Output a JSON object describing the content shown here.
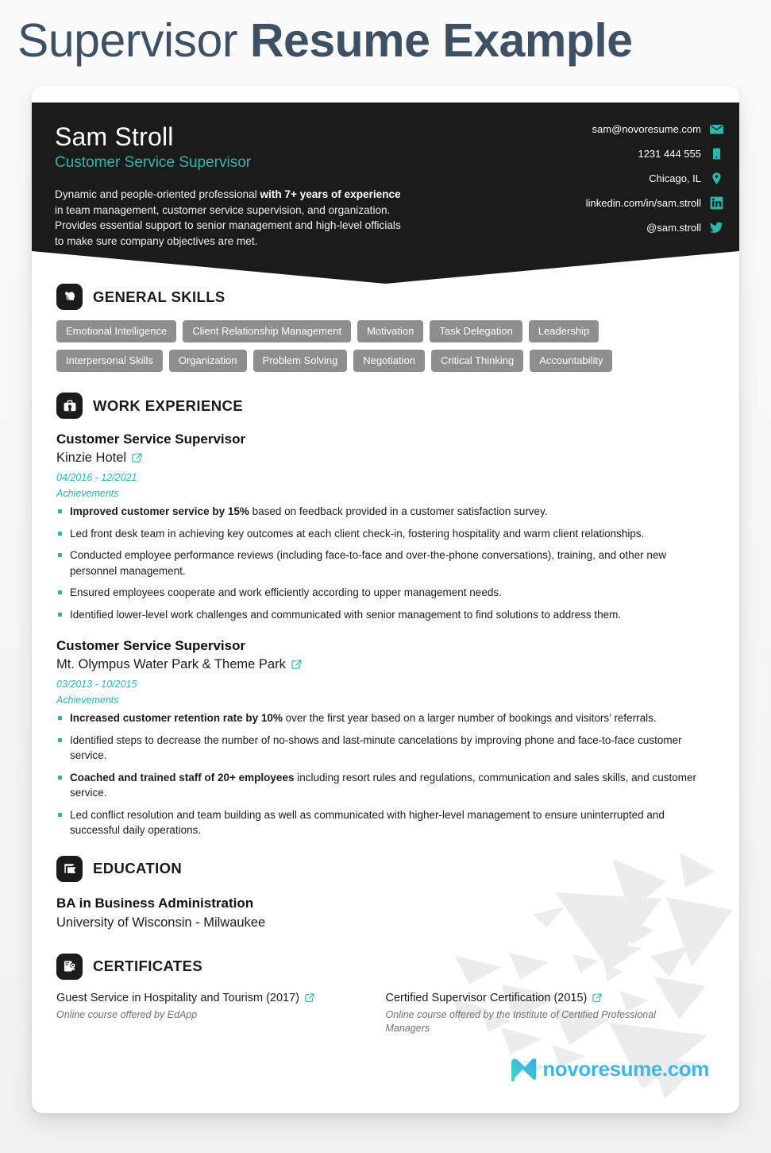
{
  "title": {
    "light": "Supervisor ",
    "bold": "Resume Example"
  },
  "header": {
    "name": "Sam Stroll",
    "role": "Customer Service Supervisor",
    "summary_pre": "Dynamic and people-oriented professional ",
    "summary_bold": "with 7+ years of experience",
    "summary_post": " in team management, customer service supervision, and organization. Provides essential support to senior management and high-level officials to make sure company objectives are met.",
    "contacts": [
      {
        "icon": "email-icon",
        "text": "sam@novoresume.com"
      },
      {
        "icon": "phone-icon",
        "text": "1231 444 555"
      },
      {
        "icon": "location-pin-icon",
        "text": "Chicago, IL"
      },
      {
        "icon": "linkedin-icon",
        "text": "linkedin.com/in/sam.stroll"
      },
      {
        "icon": "twitter-icon",
        "text": "@sam.stroll"
      }
    ]
  },
  "sections": {
    "skills": {
      "title": "GENERAL SKILLS",
      "icon": "head-skills-icon",
      "items": [
        "Emotional Intelligence",
        "Client Relationship Management",
        "Motivation",
        "Task Delegation",
        "Leadership",
        "Interpersonal Skills",
        "Organization",
        "Problem Solving",
        "Negotiation",
        "Critical Thinking",
        "Accountability"
      ]
    },
    "work": {
      "title": "WORK EXPERIENCE",
      "icon": "briefcase-icon",
      "achievements_label": "Achievements",
      "jobs": [
        {
          "title": "Customer Service Supervisor",
          "company": "Kinzie Hotel",
          "dates": "04/2016 - 12/2021",
          "bullets": [
            {
              "bold": "Improved customer service by 15%",
              "rest": " based on feedback provided in a customer satisfaction survey."
            },
            {
              "bold": "",
              "rest": "Led front desk team in achieving key outcomes at each client check-in, fostering hospitality and warm client relationships."
            },
            {
              "bold": "",
              "rest": "Conducted employee performance reviews (including face-to-face and over-the-phone conversations), training, and other new personnel management."
            },
            {
              "bold": "",
              "rest": "Ensured employees cooperate and work efficiently according to upper management needs."
            },
            {
              "bold": "",
              "rest": "Identified lower-level work challenges and communicated with senior management to find solutions to address them."
            }
          ]
        },
        {
          "title": "Customer Service Supervisor",
          "company": "Mt. Olympus Water Park & Theme Park",
          "dates": "03/2013 - 10/2015",
          "bullets": [
            {
              "bold": "Increased customer retention rate by 10%",
              "rest": " over the first year based on a larger number of bookings and visitors’ referrals."
            },
            {
              "bold": "",
              "rest": "Identified steps to decrease the number of no-shows and last-minute cancelations by improving phone and face-to-face customer service."
            },
            {
              "bold": "Coached and trained staff of 20+ employees",
              "rest": " including resort rules and regulations, communication and sales skills, and customer service."
            },
            {
              "bold": "",
              "rest": "Led conflict resolution and team building as well as communicated with higher-level management to ensure uninterrupted and successful daily operations."
            }
          ]
        }
      ]
    },
    "education": {
      "title": "EDUCATION",
      "icon": "graduation-cap-icon",
      "degree": "BA in Business Administration",
      "school": "University of Wisconsin - Milwaukee"
    },
    "certificates": {
      "title": "CERTIFICATES",
      "icon": "certificate-icon",
      "items": [
        {
          "name": "Guest Service in Hospitality and Tourism (2017)",
          "desc": "Online course offered by EdApp"
        },
        {
          "name": "Certified Supervisor Certification (2015)",
          "desc": "Online course offered by the Institute of Certified Professional Managers"
        }
      ]
    }
  },
  "brand": {
    "text": "novoresume.com"
  },
  "colors": {
    "accent_teal": "#2ab8ab",
    "title_navy": "#3e5063",
    "header_black": "#1b1b1b",
    "skill_gray": "#8e8e8e",
    "brand_blue": "#3fb5e8"
  }
}
